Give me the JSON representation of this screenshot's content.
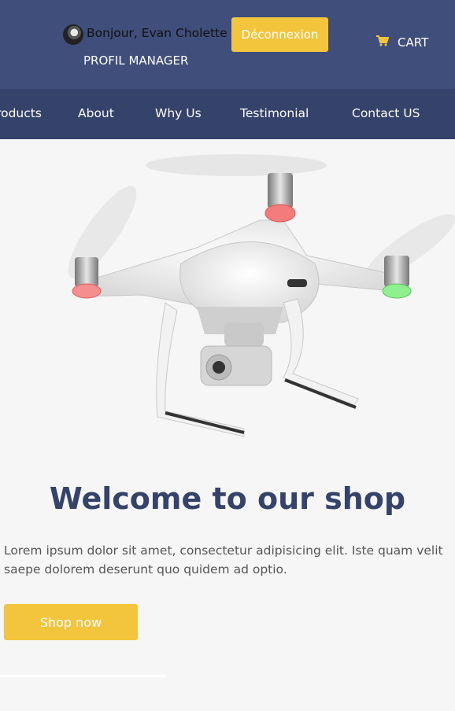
{
  "header": {
    "greeting": "Bonjour, Evan Cholette",
    "logout_label": "Déconnexion",
    "profile_label": "PROFIL MANAGER",
    "cart_label": "CART"
  },
  "nav": {
    "items": [
      "Products",
      "About",
      "Why Us",
      "Testimonial",
      "Contact US"
    ]
  },
  "hero": {
    "title": "Welcome to our shop",
    "text": "Lorem ipsum dolor sit amet, consectetur adipisicing elit. Iste quam velit saepe dolorem deserunt quo quidem ad optio.",
    "button_label": "Shop now"
  },
  "colors": {
    "header_bg": "#3f4e7a",
    "nav_bg": "#35426a",
    "accent": "#f2c53d",
    "title": "#35426a"
  },
  "icons": {
    "cart": "cart-icon",
    "avatar": "user-avatar"
  }
}
